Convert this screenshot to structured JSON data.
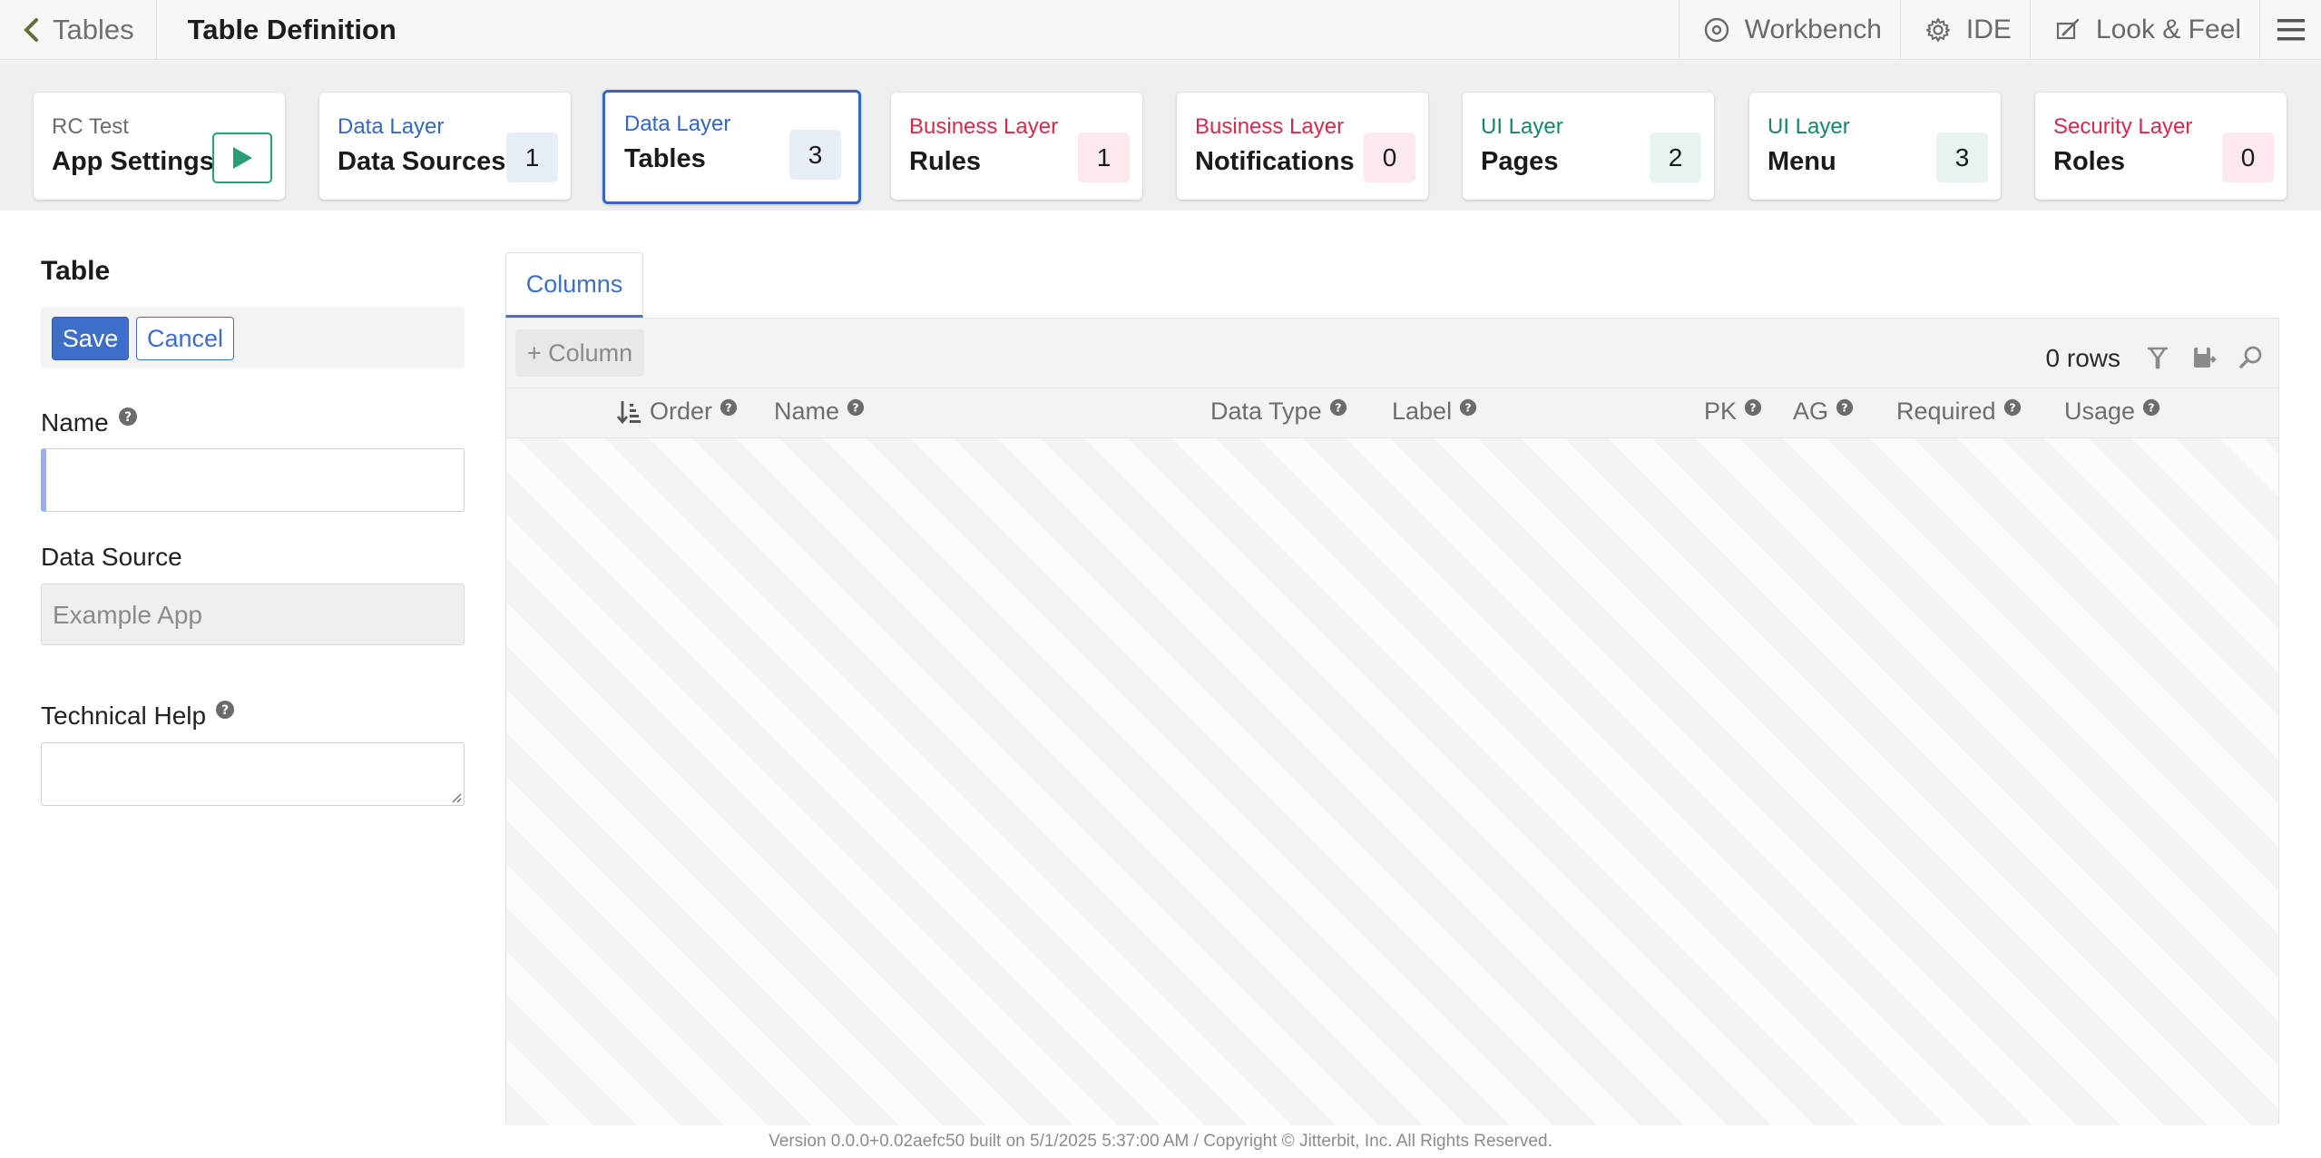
{
  "topbar": {
    "back_label": "Tables",
    "page_title": "Table Definition",
    "links": [
      {
        "label": "Workbench",
        "icon": "workbench-icon"
      },
      {
        "label": "IDE",
        "icon": "gear-icon"
      },
      {
        "label": "Look & Feel",
        "icon": "paint-icon"
      }
    ],
    "menu_icon": "hamburger-menu-icon"
  },
  "cards": [
    {
      "category": "RC Test",
      "name": "App Settings",
      "category_color": "#6b6b6b",
      "action": "play"
    },
    {
      "category": "Data Layer",
      "name": "Data Sources",
      "count": "1",
      "category_color": "#3567c2",
      "badge_color": "#e8eef8"
    },
    {
      "category": "Data Layer",
      "name": "Tables",
      "count": "3",
      "category_color": "#3567c2",
      "badge_color": "#e8eef8",
      "active": true
    },
    {
      "category": "Business Layer",
      "name": "Rules",
      "count": "1",
      "category_color": "#d6294b",
      "badge_color": "#fbe9ec"
    },
    {
      "category": "Business Layer",
      "name": "Notifications",
      "count": "0",
      "category_color": "#d6294b",
      "badge_color": "#fbe9ec"
    },
    {
      "category": "UI Layer",
      "name": "Pages",
      "count": "2",
      "category_color": "#14876a",
      "badge_color": "#e6f3ef"
    },
    {
      "category": "UI Layer",
      "name": "Menu",
      "count": "3",
      "category_color": "#14876a",
      "badge_color": "#e6f3ef"
    },
    {
      "category": "Security Layer",
      "name": "Roles",
      "count": "0",
      "category_color": "#d6294b",
      "badge_color": "#fbe9ec"
    }
  ],
  "form": {
    "title": "Table",
    "save_label": "Save",
    "cancel_label": "Cancel",
    "name_label": "Name",
    "name_value": "",
    "data_source_label": "Data Source",
    "data_source_value": "Example App",
    "technical_help_label": "Technical Help",
    "technical_help_value": ""
  },
  "grid": {
    "tab_label": "Columns",
    "add_column_label": "+ Column",
    "rows_count": "0 rows",
    "columns": [
      "Order",
      "Name",
      "Data Type",
      "Label",
      "PK",
      "AG",
      "Required",
      "Usage"
    ],
    "rows": []
  },
  "footer": {
    "text": "Version 0.0.0+0.02aefc50 built on 5/1/2025 5:37:00 AM / Copyright © Jitterbit, Inc. All Rights Reserved."
  },
  "colors": {
    "accent": "#3d6fc9",
    "success": "#2a9d78",
    "danger": "#d6294b"
  }
}
